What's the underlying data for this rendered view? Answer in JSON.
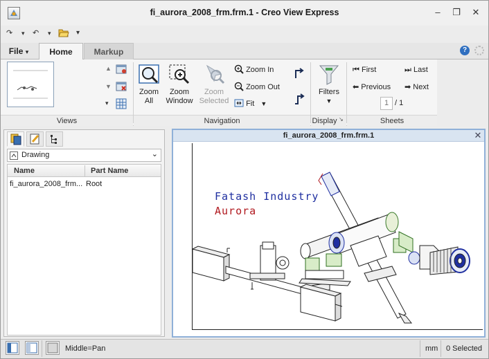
{
  "window": {
    "title": "fi_aurora_2008_frm.frm.1 - Creo View Express",
    "minimize_glyph": "–",
    "restore_glyph": "❐",
    "close_glyph": "✕"
  },
  "quick_access": {
    "redo_glyph": "↷",
    "undo_glyph": "↶",
    "dropdown_glyph": "▾",
    "open_icon": "folder-open-icon",
    "customize_glyph": "▾"
  },
  "tabs": {
    "file": "File",
    "file_caret": "▾",
    "home": "Home",
    "markup": "Markup"
  },
  "ribbon": {
    "groups": {
      "views": "Views",
      "navigation": "Navigation",
      "display": "Display",
      "sheets": "Sheets"
    },
    "zoom_all": [
      "Zoom",
      "All"
    ],
    "zoom_window": [
      "Zoom",
      "Window"
    ],
    "zoom_selected": [
      "Zoom",
      "Selected"
    ],
    "zoom_in": "Zoom In",
    "zoom_out": "Zoom Out",
    "fit": "Fit",
    "filters": "Filters",
    "first": "First",
    "last": "Last",
    "previous": "Previous",
    "next": "Next",
    "page_number": "1",
    "page_total": "/ 1"
  },
  "left_panel": {
    "view_combo": "Drawing",
    "columns": [
      "Name",
      "Part Name"
    ],
    "rows": [
      {
        "name": "fi_aurora_2008_frm...",
        "part_name": "Root"
      }
    ]
  },
  "viewer": {
    "title": "fi_aurora_2008_frm.frm.1",
    "close_glyph": "✕",
    "drawing_text_1": "Fatash Industry",
    "drawing_text_2": "Aurora",
    "colors": {
      "text1": "#1f2fa0",
      "text2": "#b0181e",
      "frame": "#8fb0d8"
    }
  },
  "status_bar": {
    "mouse_mode": "Middle=Pan",
    "units": "mm",
    "selection": "0 Selected"
  }
}
